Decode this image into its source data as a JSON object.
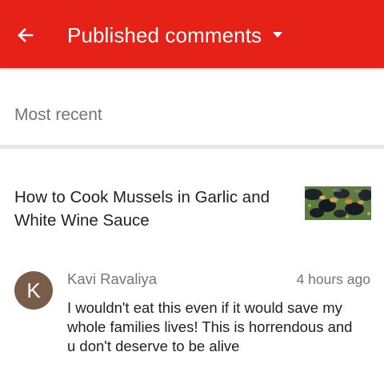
{
  "appbar": {
    "back_icon": "arrow-left-icon",
    "title": "Published comments",
    "dropdown_icon": "caret-down-icon",
    "background": "#e62117"
  },
  "filter": {
    "label": "Most recent"
  },
  "video": {
    "title": "How to Cook Mussels in Garlic and White Wine Sauce",
    "thumbnail": "mussels-thumbnail"
  },
  "comment": {
    "avatar_letter": "K",
    "author": "Kavi Ravaliya",
    "time": "4 hours ago",
    "text": "I wouldn't eat this even if it would save my whole families lives! This is horrendous and u don't deserve to be alive"
  }
}
